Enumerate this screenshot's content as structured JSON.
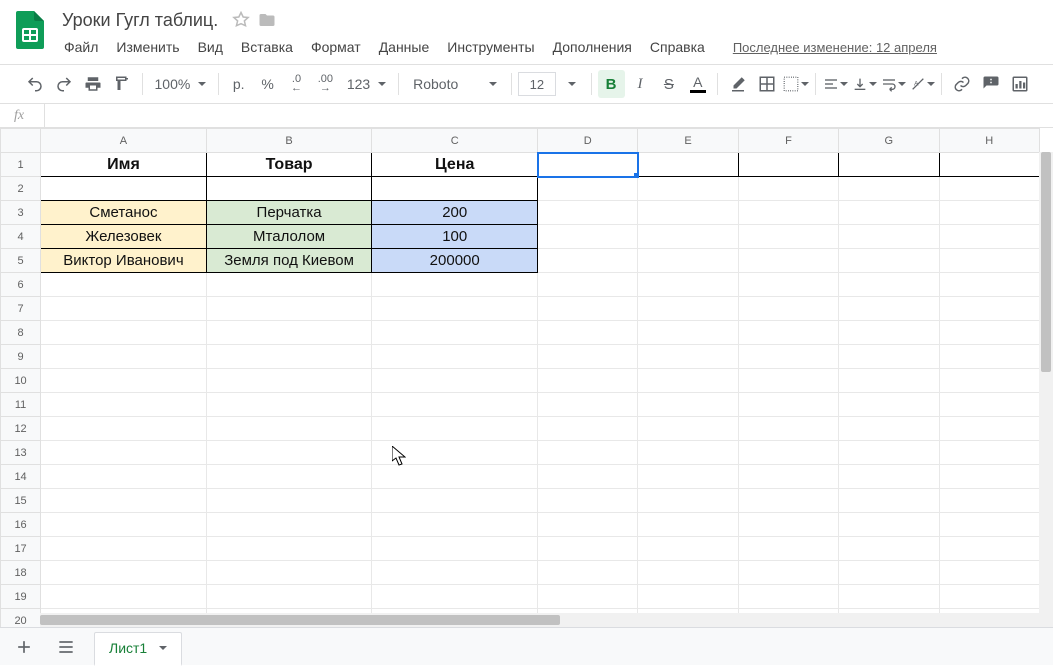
{
  "doc": {
    "title": "Уроки Гугл таблиц."
  },
  "menu": {
    "file": "Файл",
    "edit": "Изменить",
    "view": "Вид",
    "insert": "Вставка",
    "format": "Формат",
    "data": "Данные",
    "tools": "Инструменты",
    "addons": "Дополнения",
    "help": "Справка",
    "last_change": "Последнее изменение: 12 апреля"
  },
  "toolbar": {
    "zoom": "100%",
    "currency_symbol": "р.",
    "percent": "%",
    "dec_dec": ".0",
    "inc_dec": ".00",
    "num_fmt": "123",
    "font": "Roboto",
    "font_size": "12"
  },
  "formula": {
    "fx": "fx",
    "value": ""
  },
  "columns": [
    "A",
    "B",
    "C",
    "D",
    "E",
    "F",
    "G",
    "H"
  ],
  "row_count": 21,
  "active_cell": "D1",
  "header": {
    "a": "Имя",
    "b": "Товар",
    "c": "Цена"
  },
  "data_rows": [
    {
      "a": "Сметанос",
      "b": "Перчатка",
      "c": "200"
    },
    {
      "a": "Железовек",
      "b": "Мталолом",
      "c": "100"
    },
    {
      "a": "Виктор Иванович",
      "b": "Земля под Киевом",
      "c": "200000"
    }
  ],
  "tab": {
    "name": "Лист1"
  }
}
